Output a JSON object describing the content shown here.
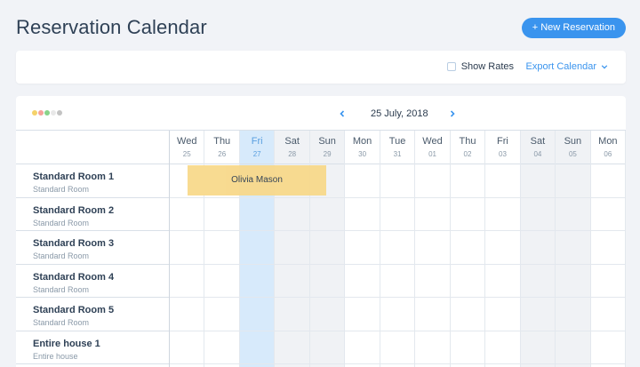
{
  "page": {
    "title": "Reservation Calendar"
  },
  "actions": {
    "new_reservation": "+ New Reservation"
  },
  "toolbar": {
    "show_rates": "Show Rates",
    "export": "Export Calendar"
  },
  "calendar": {
    "current_date": "25 July, 2018",
    "legend_colors": [
      "#f5d26a",
      "#f6a39a",
      "#89d38a",
      "#e8e8e8",
      "#c3c3c3"
    ],
    "days": [
      {
        "name": "Wed",
        "num": "25",
        "state": "normal"
      },
      {
        "name": "Thu",
        "num": "26",
        "state": "normal"
      },
      {
        "name": "Fri",
        "num": "27",
        "state": "today"
      },
      {
        "name": "Sat",
        "num": "28",
        "state": "weekend"
      },
      {
        "name": "Sun",
        "num": "29",
        "state": "weekend"
      },
      {
        "name": "Mon",
        "num": "30",
        "state": "normal"
      },
      {
        "name": "Tue",
        "num": "31",
        "state": "normal"
      },
      {
        "name": "Wed",
        "num": "01",
        "state": "normal"
      },
      {
        "name": "Thu",
        "num": "02",
        "state": "normal"
      },
      {
        "name": "Fri",
        "num": "03",
        "state": "normal"
      },
      {
        "name": "Sat",
        "num": "04",
        "state": "weekend"
      },
      {
        "name": "Sun",
        "num": "05",
        "state": "weekend"
      },
      {
        "name": "Mon",
        "num": "06",
        "state": "normal"
      }
    ],
    "rooms": [
      {
        "name": "Standard Room 1",
        "type": "Standard Room"
      },
      {
        "name": "Standard Room 2",
        "type": "Standard Room"
      },
      {
        "name": "Standard Room 3",
        "type": "Standard Room"
      },
      {
        "name": "Standard Room 4",
        "type": "Standard Room"
      },
      {
        "name": "Standard Room 5",
        "type": "Standard Room"
      },
      {
        "name": "Entire house 1",
        "type": "Entire house"
      }
    ],
    "booking": {
      "guest": "Olivia Mason",
      "color": "#f8d98b"
    }
  }
}
